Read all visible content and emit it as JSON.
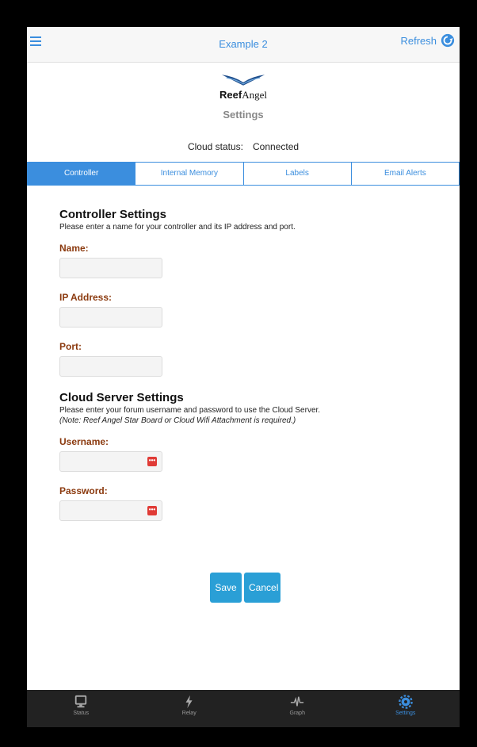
{
  "header": {
    "title": "Example 2",
    "refresh_label": "Refresh"
  },
  "brand": {
    "logo_bold": "Reef",
    "logo_light": "Angel",
    "subtitle": "Settings"
  },
  "cloud": {
    "label": "Cloud status:",
    "value": "Connected"
  },
  "tabs": [
    {
      "label": "Controller",
      "active": true
    },
    {
      "label": "Internal Memory",
      "active": false
    },
    {
      "label": "Labels",
      "active": false
    },
    {
      "label": "Email Alerts",
      "active": false
    }
  ],
  "controller_settings": {
    "heading": "Controller Settings",
    "description": "Please enter a name for your controller and its IP address and port.",
    "fields": {
      "name": {
        "label": "Name:",
        "value": ""
      },
      "ip": {
        "label": "IP Address:",
        "value": ""
      },
      "port": {
        "label": "Port:",
        "value": ""
      }
    }
  },
  "cloud_settings": {
    "heading": "Cloud Server Settings",
    "description": "Please enter your forum username and password to use the Cloud Server.",
    "note": "(Note: Reef Angel Star Board or Cloud Wifi Attachment is required.)",
    "fields": {
      "username": {
        "label": "Username:",
        "value": ""
      },
      "password": {
        "label": "Password:",
        "value": ""
      }
    }
  },
  "actions": {
    "save": "Save",
    "cancel": "Cancel"
  },
  "footer": [
    {
      "label": "Status",
      "icon": "monitor-icon",
      "active": false
    },
    {
      "label": "Relay",
      "icon": "lightning-icon",
      "active": false
    },
    {
      "label": "Graph",
      "icon": "pulse-icon",
      "active": false
    },
    {
      "label": "Settings",
      "icon": "gear-icon",
      "active": true
    }
  ],
  "colors": {
    "accent": "#3b8ede",
    "label": "#8b3a0f",
    "button": "#2a9fd6",
    "footer_bg": "#222222",
    "password_badge": "#e03b36"
  }
}
